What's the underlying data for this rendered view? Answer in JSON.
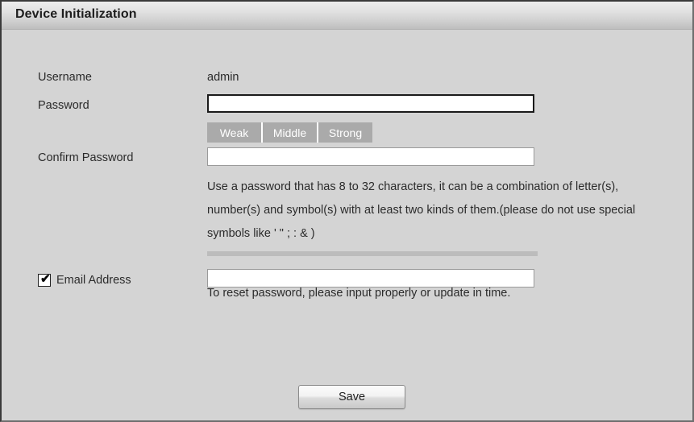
{
  "window": {
    "title": "Device Initialization"
  },
  "form": {
    "username": {
      "label": "Username",
      "value": "admin"
    },
    "password": {
      "label": "Password",
      "value": "",
      "placeholder": ""
    },
    "strength_meter": {
      "segments": [
        "Weak",
        "Middle",
        "Strong"
      ]
    },
    "confirm_password": {
      "label": "Confirm Password",
      "value": "",
      "placeholder": ""
    },
    "password_hint": "Use a password that has 8 to 32 characters, it can be a combination of letter(s), number(s) and symbol(s) with at least two kinds of them.(please do not use special symbols like ' \" ; : & )",
    "email": {
      "label": "Email Address",
      "checked_glyph": "✔",
      "value": "",
      "placeholder": "",
      "hint": "To reset password, please input properly or update in time."
    }
  },
  "actions": {
    "save_label": "Save"
  },
  "colors": {
    "window_background": "#d4d4d4",
    "titlebar_top": "#ededed",
    "titlebar_bottom": "#bdbdbd",
    "strength_meter": "#aaaaaa",
    "divider": "#bcbcbc",
    "text": "#2b2b2b"
  }
}
